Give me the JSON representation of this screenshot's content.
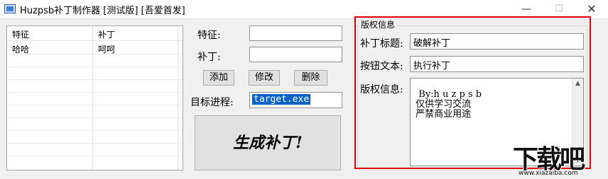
{
  "window": {
    "title": "Huzpsb补丁制作器 [测试版] [吾爱首发]",
    "icons": [
      "app-icon",
      "minimize-icon",
      "maximize-icon",
      "close-icon"
    ]
  },
  "list": {
    "columns": [
      "特征",
      "补丁"
    ],
    "rows": [
      [
        "哈哈",
        "呵呵"
      ]
    ]
  },
  "form": {
    "feature_label": "特征:",
    "feature_value": "",
    "patch_label": "补丁:",
    "patch_value": "",
    "add_label": "添加",
    "edit_label": "修改",
    "delete_label": "删除",
    "target_label": "目标进程:",
    "target_value": "target.exe",
    "generate_label": "生成补丁!"
  },
  "copyright": {
    "group_title": "版权信息",
    "patch_title_label": "补丁标题:",
    "patch_title_value": "破解补丁",
    "button_text_label": "按钮文本:",
    "button_text_value": "执行补丁",
    "info_label": "版权信息:",
    "info_value": "By:h u z p s b\n 仅供学习交流\n 严禁商业用途"
  },
  "watermark": {
    "logo_text": "下载吧",
    "url": "www.xiazaiba.com"
  },
  "colors": {
    "highlight": "#e8000b",
    "selection": "#0a64c8"
  }
}
